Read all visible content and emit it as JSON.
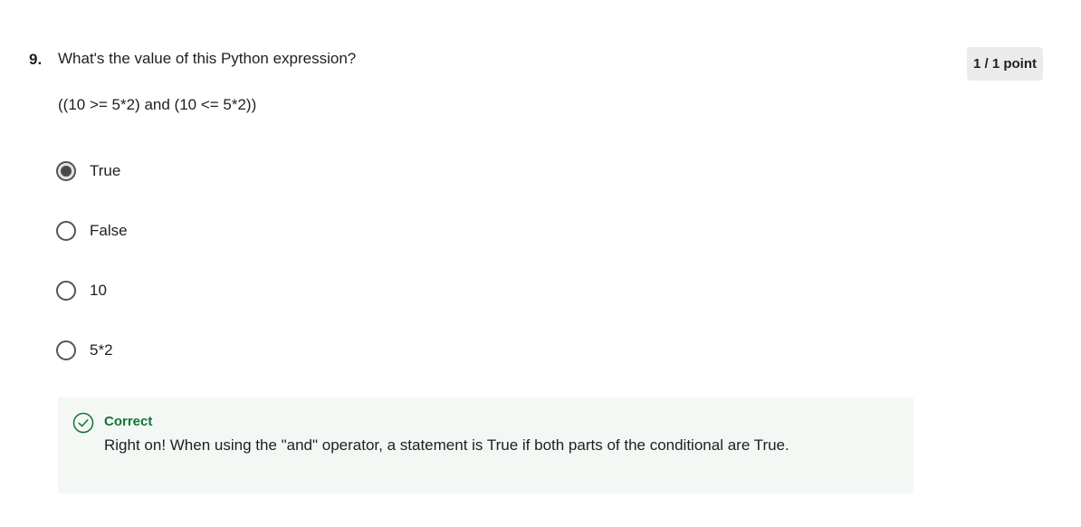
{
  "question": {
    "number": "9.",
    "title": "What's the value of this Python expression?",
    "expression": "((10 >= 5*2) and (10 <= 5*2))"
  },
  "score": {
    "label": "1 / 1 point"
  },
  "options": [
    {
      "label": "True",
      "selected": true
    },
    {
      "label": "False",
      "selected": false
    },
    {
      "label": "10",
      "selected": false
    },
    {
      "label": "5*2",
      "selected": false
    }
  ],
  "feedback": {
    "status": "Correct",
    "message": "Right on! When using the \"and\" operator, a statement is True if both parts of the conditional are True.",
    "icon": "check-circle-icon",
    "color": "#137333",
    "background": "#f4f8f5"
  }
}
